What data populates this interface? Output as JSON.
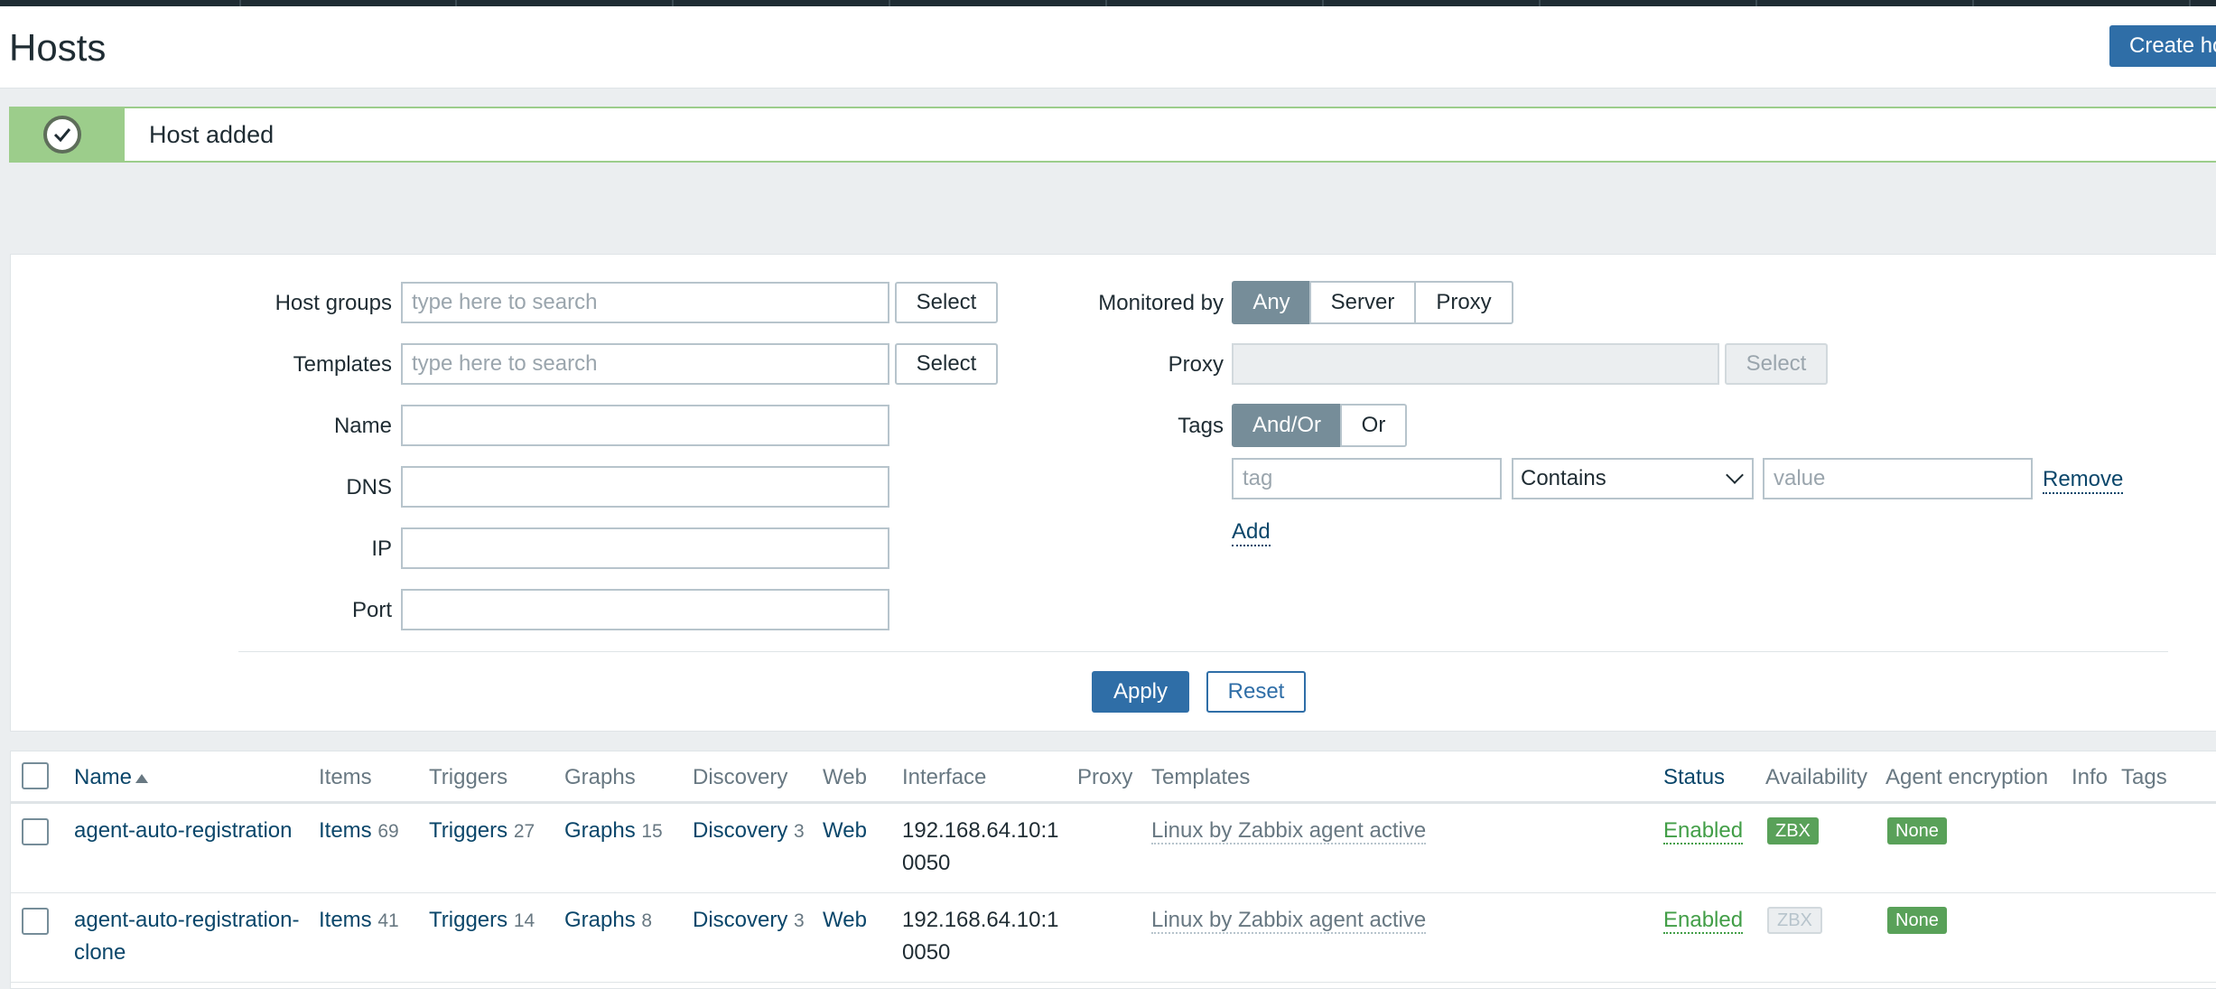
{
  "page": {
    "title": "Hosts",
    "create_label": "Create ho"
  },
  "message": {
    "text": "Host added"
  },
  "filter": {
    "host_groups": {
      "label": "Host groups",
      "placeholder": "type here to search",
      "select": "Select"
    },
    "templates": {
      "label": "Templates",
      "placeholder": "type here to search",
      "select": "Select"
    },
    "name": {
      "label": "Name"
    },
    "dns": {
      "label": "DNS"
    },
    "ip": {
      "label": "IP"
    },
    "port": {
      "label": "Port"
    },
    "monitored_by": {
      "label": "Monitored by",
      "options": [
        "Any",
        "Server",
        "Proxy"
      ],
      "selected": "Any"
    },
    "proxy": {
      "label": "Proxy",
      "select": "Select"
    },
    "tags": {
      "label": "Tags",
      "options": [
        "And/Or",
        "Or"
      ],
      "selected": "And/Or",
      "tag_placeholder": "tag",
      "operator": "Contains",
      "value_placeholder": "value",
      "remove": "Remove",
      "add": "Add"
    },
    "apply": "Apply",
    "reset": "Reset"
  },
  "table": {
    "headers": {
      "name": "Name",
      "items": "Items",
      "triggers": "Triggers",
      "graphs": "Graphs",
      "discovery": "Discovery",
      "web": "Web",
      "interface": "Interface",
      "proxy": "Proxy",
      "templates": "Templates",
      "status": "Status",
      "availability": "Availability",
      "agent_encryption": "Agent encryption",
      "info": "Info",
      "tags": "Tags"
    },
    "rows": [
      {
        "name_line1": "agent-auto-registration",
        "name_line2": "",
        "items": "Items",
        "items_count": "69",
        "triggers": "Triggers",
        "triggers_count": "27",
        "graphs": "Graphs",
        "graphs_count": "15",
        "discovery": "Discovery",
        "discovery_count": "3",
        "web": "Web",
        "interface_line1": "192.168.64.10:1",
        "interface_line2": "0050",
        "template": "Linux by Zabbix agent active",
        "status": "Enabled",
        "availability": "ZBX",
        "encryption": "None"
      },
      {
        "name_line1": "agent-auto-registration-",
        "name_line2": "clone",
        "items": "Items",
        "items_count": "41",
        "triggers": "Triggers",
        "triggers_count": "14",
        "graphs": "Graphs",
        "graphs_count": "8",
        "discovery": "Discovery",
        "discovery_count": "3",
        "web": "Web",
        "interface_line1": "192.168.64.10:1",
        "interface_line2": "0050",
        "template": "Linux by Zabbix agent active",
        "status": "Enabled",
        "availability": "ZBX",
        "encryption": "None"
      }
    ]
  }
}
